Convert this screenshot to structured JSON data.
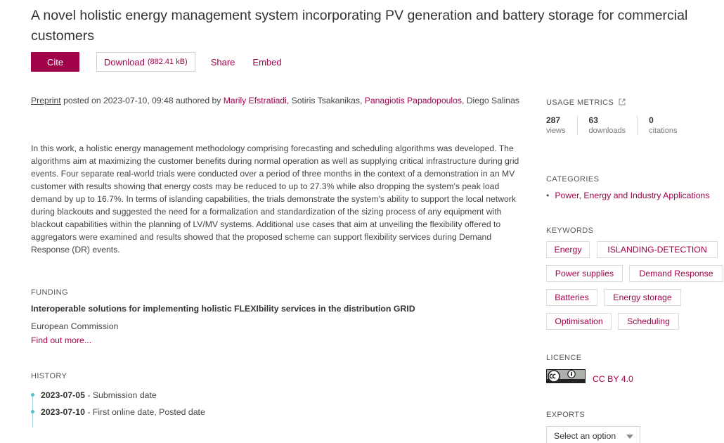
{
  "title": "A novel holistic energy management system incorporating PV generation and battery storage for commercial customers",
  "actions": {
    "cite": "Cite",
    "download": "Download",
    "download_size": "(882.41 kB)",
    "share": "Share",
    "embed": "Embed"
  },
  "meta": {
    "type": "Preprint",
    "posted_prefix": " posted on 2023-07-10, 09:48 authored by ",
    "authors": [
      {
        "name": "Marily Efstratiadi",
        "linked": true
      },
      {
        "name": "Sotiris Tsakanikas",
        "linked": false
      },
      {
        "name": "Panagiotis Papadopoulos",
        "linked": true
      },
      {
        "name": "Diego Salinas",
        "linked": false
      }
    ],
    "separator": ", "
  },
  "abstract": "In this work, a holistic energy management methodology comprising forecasting and scheduling algorithms was developed. The algorithms aim at maximizing the customer benefits during normal operation as well as supplying critical infrastructure during grid events. Four separate real-world trials were conducted over a period of three months in the context of a demonstration in an MV customer with results showing that energy costs may be reduced to up to 27.3% while also dropping the system's peak load demand by up to 16.7%. In terms of islanding capabilities, the trials demonstrate the system's ability to support the local network during blackouts and suggested the need for a formalization and standardization of the sizing process of any equipment with blackout capabilities within the planning of LV/MV systems. Additional use cases that aim at unveiling the flexibility offered to aggregators were examined and results showed that the proposed scheme can support flexibility services during Demand Response (DR) events.",
  "funding": {
    "heading": "FUNDING",
    "title": "Interoperable solutions for implementing holistic FLEXIbility services in the distribution GRID",
    "org": "European Commission",
    "link": "Find out more..."
  },
  "history": {
    "heading": "HISTORY",
    "items": [
      {
        "date": "2023-07-05",
        "label": " - Submission date"
      },
      {
        "date": "2023-07-10",
        "label": " - First online date, Posted date"
      }
    ]
  },
  "sidebar": {
    "metrics_heading": "USAGE METRICS",
    "metrics": [
      {
        "value": "287",
        "label": "views"
      },
      {
        "value": "63",
        "label": "downloads"
      },
      {
        "value": "0",
        "label": "citations"
      }
    ],
    "categories_heading": "CATEGORIES",
    "categories": [
      "Power, Energy and Industry Applications"
    ],
    "keywords_heading": "KEYWORDS",
    "keywords": [
      "Energy",
      "ISLANDING-DETECTION",
      "Power supplies",
      "Demand Response",
      "Batteries",
      "Energy storage",
      "Optimisation",
      "Scheduling"
    ],
    "licence_heading": "LICENCE",
    "licence": "CC BY 4.0",
    "exports_heading": "EXPORTS",
    "exports_select": "Select an option"
  }
}
